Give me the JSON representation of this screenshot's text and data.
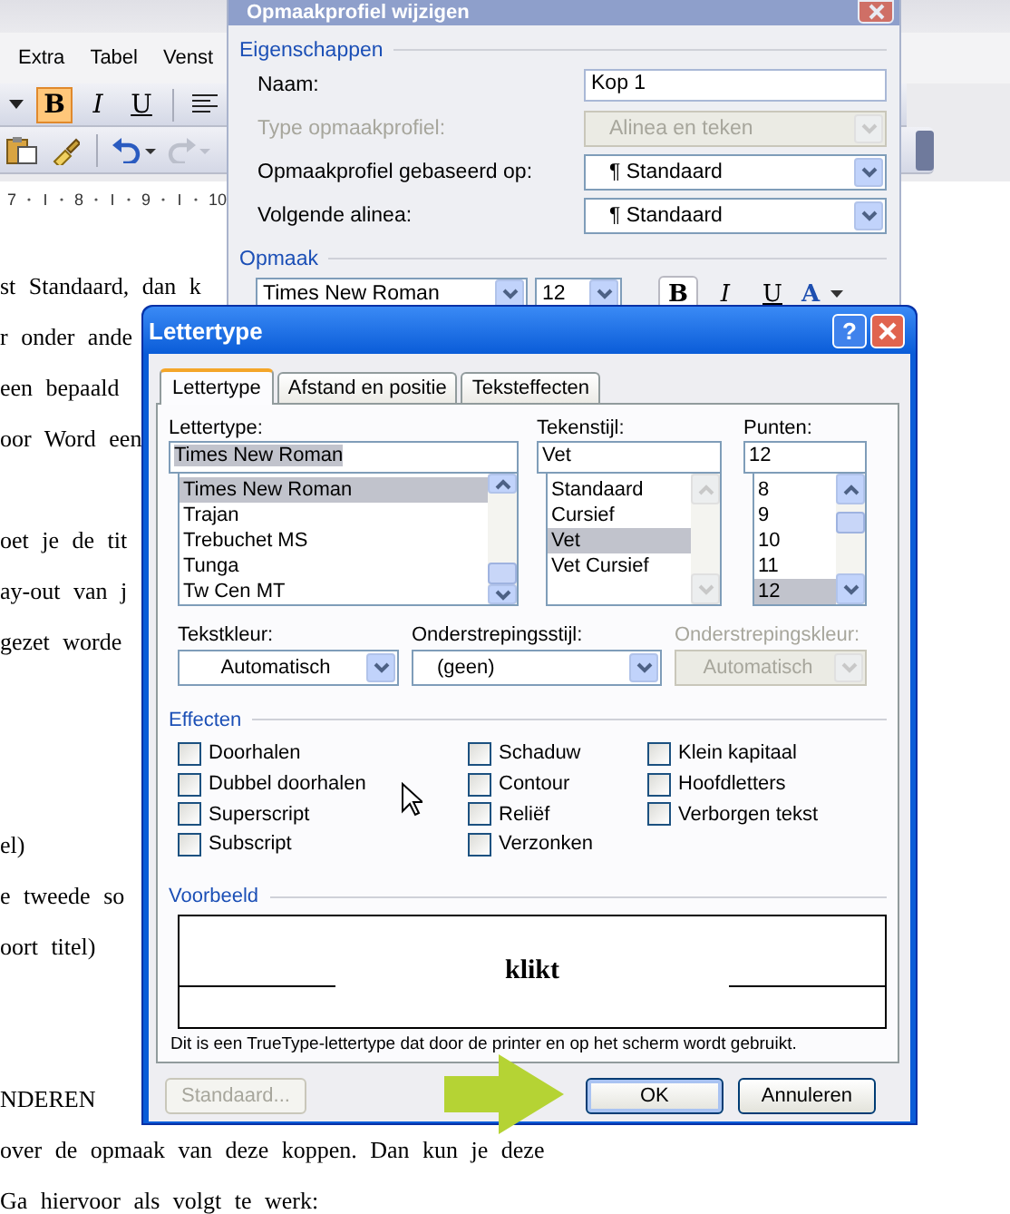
{
  "menu_bar": {
    "items": [
      "Extra",
      "Tabel",
      "Venst"
    ]
  },
  "toolbar_formatting": [
    {
      "kind": "dropdown",
      "on": false
    },
    {
      "kind": "bold",
      "label": "B",
      "on": true
    },
    {
      "kind": "italic",
      "label": "I",
      "on": false
    },
    {
      "kind": "underline",
      "label": "U",
      "on": false
    },
    {
      "kind": "align-left",
      "on": false
    }
  ],
  "toolbar_standard": [
    {
      "kind": "paste",
      "disabled": false
    },
    {
      "kind": "brush",
      "disabled": false
    },
    {
      "kind": "undo",
      "disabled": false
    },
    {
      "kind": "redo",
      "disabled": true
    }
  ],
  "ruler": {
    "labels": [
      "7",
      "8",
      "9",
      "10"
    ]
  },
  "document": {
    "paragraphs": [
      [
        "st Standaard, dan k",
        "r onder ande",
        "een bepaald",
        "oor Word een"
      ],
      [
        "oet je de tit",
        "ay-out van j",
        "gezet worde"
      ],
      [
        "el)",
        "e tweede so",
        "oort titel)"
      ],
      [
        "NDEREN",
        "over de opmaak van deze koppen. Dan kun je deze",
        "Ga hiervoor als volgt te werk:"
      ]
    ]
  },
  "style_dialog": {
    "title": "Opmaakprofiel wijzigen",
    "properties_heading": "Eigenschappen",
    "fields": [
      {
        "label": "Naam:",
        "kind": "text",
        "value": "Kop 1",
        "disabled": false
      },
      {
        "label": "Type opmaakprofiel:",
        "kind": "select",
        "value": "Alinea en teken",
        "disabled": true
      },
      {
        "label": "Opmaakprofiel gebaseerd op:",
        "kind": "select",
        "value": "¶ Standaard",
        "disabled": false
      },
      {
        "label": "Volgende alinea:",
        "kind": "select",
        "value": "¶ Standaard",
        "disabled": false
      }
    ],
    "format_heading": "Opmaak",
    "font": "Times New Roman",
    "size": "12",
    "format_buttons": [
      {
        "kind": "bold",
        "label": "B",
        "on": true
      },
      {
        "kind": "italic",
        "label": "I",
        "on": false
      },
      {
        "kind": "underline",
        "label": "U",
        "on": false
      },
      {
        "kind": "color",
        "label": "A",
        "on": false
      }
    ]
  },
  "font_dialog": {
    "title": "Lettertype",
    "help_label": "?",
    "tabs": [
      {
        "label": "Lettertype",
        "selected": true
      },
      {
        "label": "Afstand en positie",
        "selected": false
      },
      {
        "label": "Teksteffecten",
        "selected": false
      }
    ],
    "pickers": [
      {
        "label": "Lettertype:",
        "value": "Times New Roman",
        "value_selected": true,
        "scroll_enabled": true,
        "items": [
          {
            "text": "Times New Roman",
            "selected": true
          },
          {
            "text": "Trajan",
            "selected": false
          },
          {
            "text": "Trebuchet MS",
            "selected": false
          },
          {
            "text": "Tunga",
            "selected": false
          },
          {
            "text": "Tw Cen MT",
            "selected": false
          }
        ]
      },
      {
        "label": "Tekenstijl:",
        "value": "Vet",
        "value_selected": false,
        "scroll_enabled": false,
        "items": [
          {
            "text": "Standaard",
            "selected": false
          },
          {
            "text": "Cursief",
            "selected": false
          },
          {
            "text": "Vet",
            "selected": true
          },
          {
            "text": "Vet Cursief",
            "selected": false
          }
        ]
      },
      {
        "label": "Punten:",
        "value": "12",
        "value_selected": false,
        "scroll_enabled": true,
        "items": [
          {
            "text": "8",
            "selected": false
          },
          {
            "text": "9",
            "selected": false
          },
          {
            "text": "10",
            "selected": false
          },
          {
            "text": "11",
            "selected": false
          },
          {
            "text": "12",
            "selected": true
          }
        ]
      }
    ],
    "dropdowns": [
      {
        "label": "Tekstkleur:",
        "value": "Automatisch",
        "kind": "color",
        "disabled": false
      },
      {
        "label": "Onderstrepingsstijl:",
        "value": "(geen)",
        "kind": "style",
        "disabled": false
      },
      {
        "label": "Onderstrepingskleur:",
        "value": "Automatisch",
        "kind": "color",
        "disabled": true
      }
    ],
    "effects_heading": "Effecten",
    "effects": [
      [
        {
          "label": "Doorhalen",
          "checked": false
        },
        {
          "label": "Dubbel doorhalen",
          "checked": false
        },
        {
          "label": "Superscript",
          "checked": false
        },
        {
          "label": "Subscript",
          "checked": false
        }
      ],
      [
        {
          "label": "Schaduw",
          "checked": false
        },
        {
          "label": "Contour",
          "checked": false
        },
        {
          "label": "Reliëf",
          "checked": false
        },
        {
          "label": "Verzonken",
          "checked": false
        }
      ],
      [
        {
          "label": "Klein kapitaal",
          "checked": false
        },
        {
          "label": "Hoofdletters",
          "checked": false
        },
        {
          "label": "Verborgen tekst",
          "checked": false
        }
      ]
    ],
    "preview_heading": "Voorbeeld",
    "preview_sample": "klikt",
    "font_note": "Dit is een TrueType-lettertype dat door de printer en op het scherm wordt gebruikt.",
    "buttons": [
      {
        "label": "Standaard...",
        "disabled": true,
        "default": false
      },
      {
        "label": "OK",
        "disabled": false,
        "default": true
      },
      {
        "label": "Annuleren",
        "disabled": false,
        "default": false
      }
    ]
  }
}
